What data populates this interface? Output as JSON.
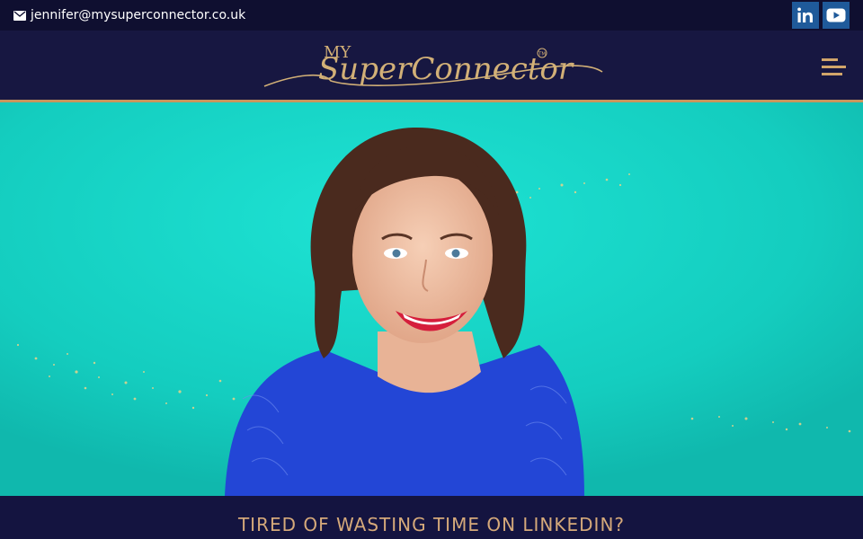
{
  "topbar": {
    "email": "jennifer@mysuperconnector.co.uk",
    "icons": {
      "email": "envelope-icon",
      "linkedin": "linkedin-icon",
      "youtube": "youtube-icon"
    }
  },
  "header": {
    "logo": {
      "line1": "MY",
      "line2": "SuperConnector",
      "mark": "TM"
    },
    "menu_icon": "hamburger-menu-icon"
  },
  "hero": {
    "image": "woman-in-blue-lace-top-smiling-portrait"
  },
  "tagline": "TIRED OF WASTING TIME ON LINKEDIN?",
  "colors": {
    "topbar_bg": "#0f0f30",
    "header_bg": "#171741",
    "accent_gold": "#d1a56a",
    "hero_teal": "#17d3c5",
    "social_blue": "#1f5a9a"
  }
}
